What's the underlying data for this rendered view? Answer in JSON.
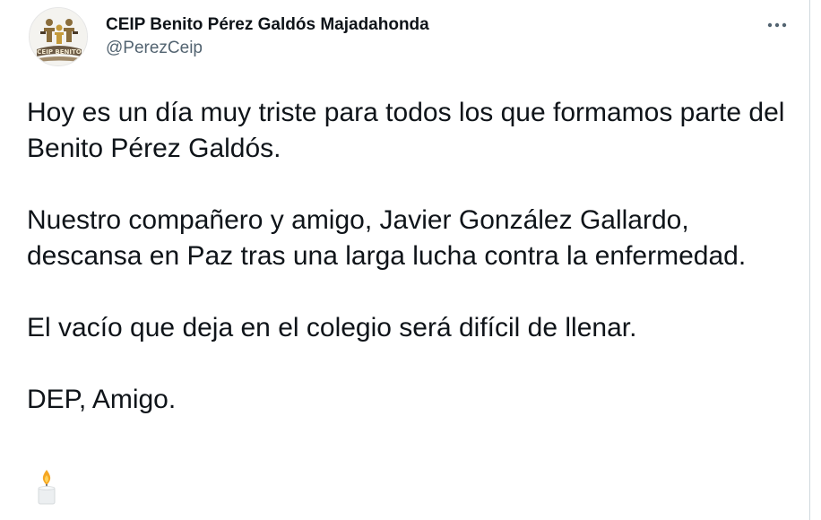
{
  "account": {
    "display_name": "CEIP Benito Pérez Galdós Majadahonda",
    "handle": "@PerezCeip",
    "avatar_text": "CEIP BENITO"
  },
  "menu": {
    "icon": "more-horizontal-icon"
  },
  "tweet": {
    "paragraphs": [
      "Hoy es un día muy triste para todos los que formamos parte del Benito Pérez Galdós.",
      "Nuestro compañero y amigo, Javier González Gallardo, descansa en Paz tras una larga lucha contra la enfermedad.",
      "El vacío que deja en el colegio será difícil de llenar.",
      "DEP, Amigo."
    ],
    "emoji": "candle-icon"
  },
  "colors": {
    "text": "#0f1419",
    "secondary": "#536471",
    "border": "#cfd9de"
  }
}
